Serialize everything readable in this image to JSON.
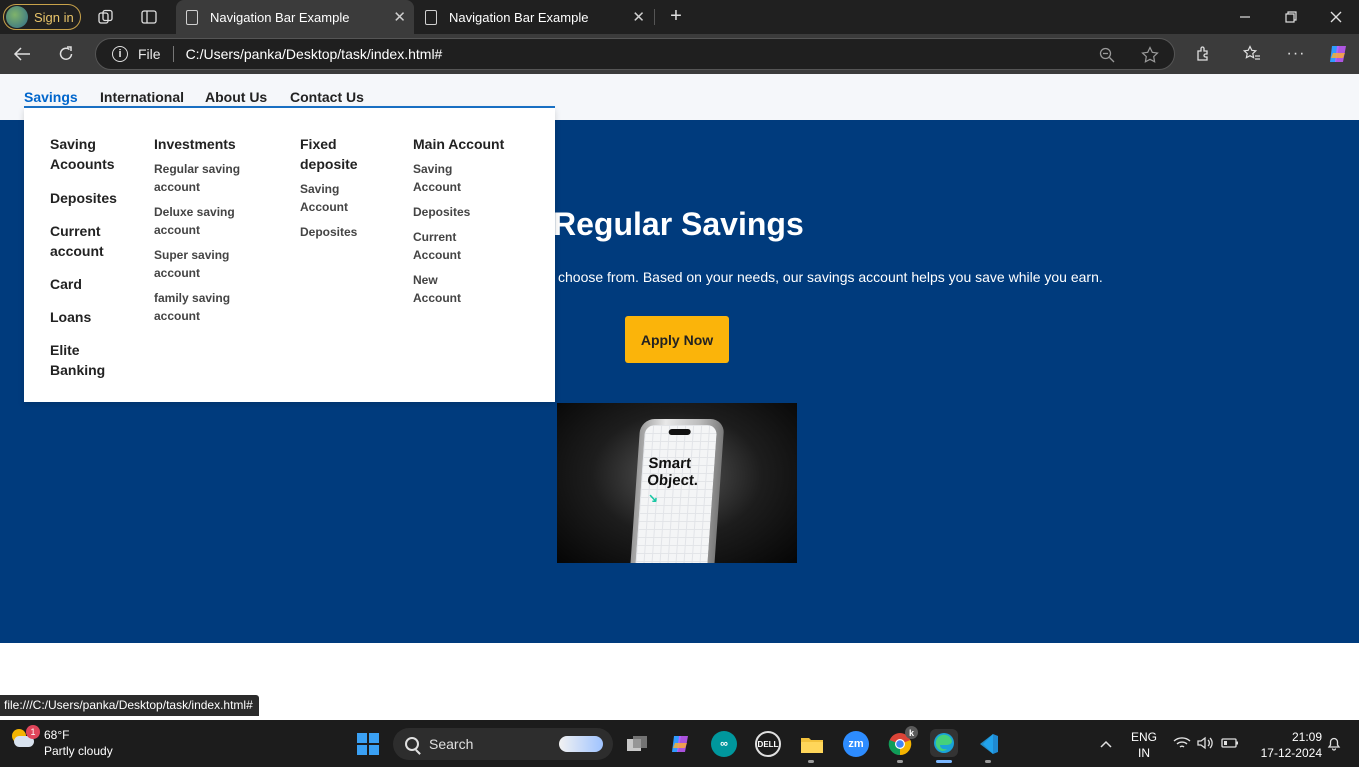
{
  "browser": {
    "signin_label": "Sign in",
    "tabs": [
      {
        "title": "Navigation Bar Example",
        "active": true
      },
      {
        "title": "Navigation Bar Example",
        "active": false
      }
    ],
    "address": {
      "scheme_label": "File",
      "url": "C:/Users/panka/Desktop/task/index.html#"
    },
    "status_url": "file:///C:/Users/panka/Desktop/task/index.html#"
  },
  "nav": {
    "items": [
      "Savings",
      "International",
      "About Us",
      "Contact Us"
    ],
    "active": "Savings"
  },
  "dropdown": {
    "col1": [
      "Saving Acoounts",
      "Deposites",
      "Current account",
      "Card",
      "Loans",
      "Elite Banking"
    ],
    "col2": {
      "title": "Investments",
      "items": [
        "Regular saving account",
        "Deluxe saving account",
        "Super saving account",
        "family saving account"
      ]
    },
    "col3": {
      "title": "Fixed deposite",
      "items": [
        "Saving Account",
        "Deposites"
      ]
    },
    "col4": {
      "title": "Main Account",
      "items": [
        "Saving Account",
        "Deposites",
        "Current Account",
        "New Account"
      ]
    }
  },
  "hero": {
    "title": "Regular Savings",
    "description": "choose from. Based on your needs, our savings account helps you save while you earn.",
    "cta_label": "Apply Now",
    "image_text": "Smart Object."
  },
  "taskbar": {
    "weather": {
      "temp": "68°F",
      "condition": "Partly cloudy",
      "badge": "1"
    },
    "search_label": "Search",
    "lang_line1": "ENG",
    "lang_line2": "IN",
    "time": "21:09",
    "date": "17-12-2024",
    "chrome_badge": "k"
  },
  "colors": {
    "hero_bg": "#003b7d",
    "cta_bg": "#fbb40a",
    "nav_active": "#0066cc"
  }
}
